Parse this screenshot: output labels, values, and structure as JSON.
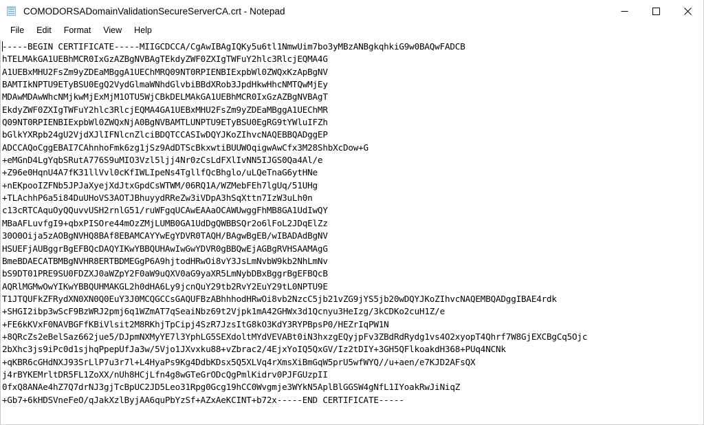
{
  "window": {
    "title": "COMODORSADomainValidationSecureServerCA.crt - Notepad",
    "icon": "notepad-document-icon",
    "controls": {
      "minimize_label": "Minimize",
      "maximize_label": "Maximize",
      "close_label": "Close"
    }
  },
  "menu": {
    "items": [
      {
        "label": "File"
      },
      {
        "label": "Edit"
      },
      {
        "label": "Format"
      },
      {
        "label": "View"
      },
      {
        "label": "Help"
      }
    ]
  },
  "document": {
    "lines": [
      "-----BEGIN CERTIFICATE-----MIIGCDCCA/CgAwIBAgIQKy5u6tl1NmwUim7bo3yMBzANBgkqhkiG9w0BAQwFADCB",
      "hTELMAkGA1UEBhMCR0IxGzAZBgNVBAgTEkdyZWF0ZXIgTWFuY2hlc3RlcjEQMA4G",
      "A1UEBxMHU2FsZm9yZDEaMBggA1UEChMRQ09NT0RPIENBIExpbWl0ZWQxKzApBgNV",
      "BAMTIkNPTU9ETyBSU0EgQ2VydGlmaWNhdGlvbiBBdXRob3JpdHkwHhcNMTQwMjEy",
      "MDAwMDAwWhcNMjkwMjExMjM1OTU5WjCBkDELMAkGA1UEBhMCR0IxGzAZBgNVBAgT",
      "EkdyZWF0ZXIgTWFuY2hlc3RlcjEQMA4GA1UEBxMHU2FsZm9yZDEaMBggA1UEChMR",
      "Q09NT0RPIENBIExpbWl0ZWQxNjA0BgNVBAMTLUNPTU9ETyBSU0EgRG9tYWluIFZh",
      "bGlkYXRpb24gU2VjdXJlIFNlcnZlciBDQTCCASIwDQYJKoZIhvcNAQEBBQADggEP",
      "ADCCAQoCggEBAI7CAhnhoFmk6zg1jSz9AdDTScBkxwtiBUUWOqigwAwCfx3M28ShbXcDow+G",
      "+eMGnD4LgYqbSRutA776S9uMIO3Vzl5ljj4Nr0zCsLdFXlIvNN5IJGS0Qa4Al/e",
      "+Z96e0HqnU4A7fK31llVvl0cKfIWLIpeNs4TgllfQcBhglo/uLQeTnaG6ytHNe",
      "+nEKpooIZFNb5JPJaXyejXdJtxGpdCsWTWM/06RQ1A/WZMebFEh7lgUq/51UHg",
      "+TLAchhP6a5i84DuUHoVS3AOTJBhuyydRReZw3iVDpA3hSqXttn7IzW3uLh0n",
      "c13cRTCAquOyQQuvvUSH2rnlG51/ruWFgqUCAwEAAaOCAWUwggFhMB8GA1UdIwQY",
      "MBaAFLuvfgI9+qbxPISOre44mOzZMjLUMB0GA1UdDgQWBBSQr2o6lFoL2JDqElZz",
      "30O0Oija5zAOBgNVHQ8BAf8EBAMCAYYwEgYDVR0TAQH/BAgwBgEB/wIBADAdBgNV",
      "HSUEFjAUBggrBgEFBQcDAQYIKwYBBQUHAwIwGwYDVR0gBBQwEjAGBgRVHSAAMAgG",
      "BmeBDAECATBMBgNVHR8ERTBDMEGgP6A9hjtodHRwOi8vY3JsLmNvbW9kb2NhLmNv",
      "bS9DT01PRE9SU0FDZXJ0aWZpY2F0aW9uQXV0aG9yaXR5LmNybDBxBggrBgEFBQcB",
      "AQRlMGMwOwYIKwYBBQUHMAKGL2h0dHA6Ly9jcnQuY29tb2RvY2EuY29tL0NPTU9E",
      "T1JTQUFkZFRydXN0XN0Q0EuY3J0MCQGCCsGAQUFBzABhhhodHRwOi8vb2NzcC5jb21vZG9jYS5jb20wDQYJKoZIhvcNAQEMBQADggIBAE4rdk",
      "+SHGI2ibp3wScF9BzWRJ2pmj6q1WZmAT7qSeaiNbz69t2Vjpk1mA42GHWx3d1Qcnyu3HeIzg/3kCDKo2cuH1Z/e",
      "+FE6kKVxF0NAVBGFfKBiVlsit2M8RKhjTpCipj4SzR7JzsItG8kO3KdY3RYPBpsP0/HEZrIqPW1N",
      "+8QRcZs2eBelSaz662jue5/DJpmNXMyYE7l3YphLG5SEXdoltMYdVEVABt0iN3hxzgEQyjpFv3ZBdRdRydg1vs4O2xyopT4Qhrf7W8GjEXCBgCq5Ojc",
      "2bXhc3js9iPc0d1sjhqPpepUfJa3w/5Vjo1JXvxku88+vZbrac2/4EjxYoIQ5QxGV/Iz2tDIY+3GH5QFlkoakdH368+PUq4NCNk",
      "+qKBR6cGHdNXJ93SrLlP7u3r7l+L4HyaPs9Kg4DdbKDsx5Q5XLVq4rXmsXiBmGqW5prU5wfWYQ//u+aen/e7KJD2AFsQX",
      "j4rBYKEMrltDR5FL1ZoXX/nUh8HCjLfn4g8wGTeGrODcQgPmlKidrv0PJFGUzpII",
      "0fxQ8ANAe4hZ7Q7drNJ3gjTcBpUC2JD5Leo31Rpg0Gcg19hCC0Wvgmje3WYkN5AplBlGGSW4gNfL1IYoakRwJiNiqZ",
      "+Gb7+6kHDSVneFeO/qJakXzlByjAA6quPbYzSf+AZxAeKCINT+b72x-----END CERTIFICATE-----"
    ],
    "caret_line": 0
  }
}
